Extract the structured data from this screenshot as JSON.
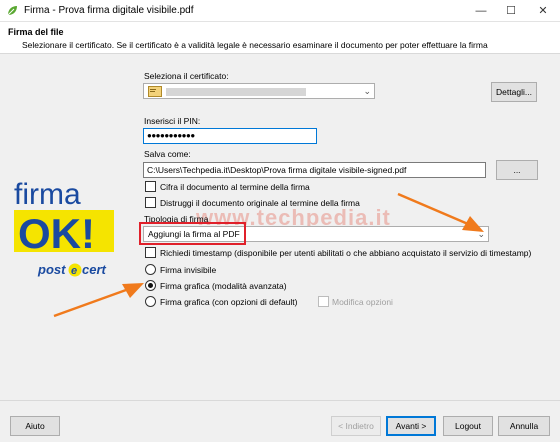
{
  "window": {
    "title": "Firma - Prova firma digitale visibile.pdf",
    "controls": [
      "—",
      "☐",
      "✕"
    ]
  },
  "header": {
    "title": "Firma del file",
    "description": "Selezionare il certificato. Se il certificato è a validità legale è necessario esaminare il documento per poter effettuare la firma"
  },
  "certificate": {
    "label": "Seleziona il certificato:",
    "details_button": "Dettagli..."
  },
  "pin": {
    "label": "Inserisci il PIN:",
    "value": "●●●●●●●●●●●"
  },
  "save_as": {
    "label": "Salva come:",
    "path": "C:\\Users\\Techpedia.it\\Desktop\\Prova firma digitale visibile-signed.pdf",
    "browse_button": "..."
  },
  "options": {
    "encrypt": "Cifra il documento al termine della firma",
    "destroy": "Distruggi il documento originale al termine della firma"
  },
  "signature_type": {
    "label": "Tipologia di firma",
    "selected": "Aggiungi la firma al PDF",
    "timestamp": "Richiedi timestamp (disponibile per utenti abilitati o che abbiano acquistato il servizio di timestamp)",
    "invisible": "Firma invisibile",
    "graphic_advanced": "Firma grafica (modalità avanzata)",
    "graphic_default": "Firma grafica (con opzioni di default)",
    "modify_options": "Modifica opzioni"
  },
  "logo": {
    "line1": "firma",
    "line2": "OK!",
    "brand_left": "post",
    "brand_mid": "e",
    "brand_right": "cert"
  },
  "watermark": "www.techpedia.it",
  "footer": {
    "help": "Aiuto",
    "back": "< Indietro",
    "next": "Avanti >",
    "logout": "Logout",
    "cancel": "Annulla"
  },
  "colors": {
    "accent": "#0078d7",
    "arrow": "#f07a1c",
    "highlight": "#e0202a",
    "logo_yellow": "#f5e400",
    "logo_blue": "#1a4aa0"
  }
}
